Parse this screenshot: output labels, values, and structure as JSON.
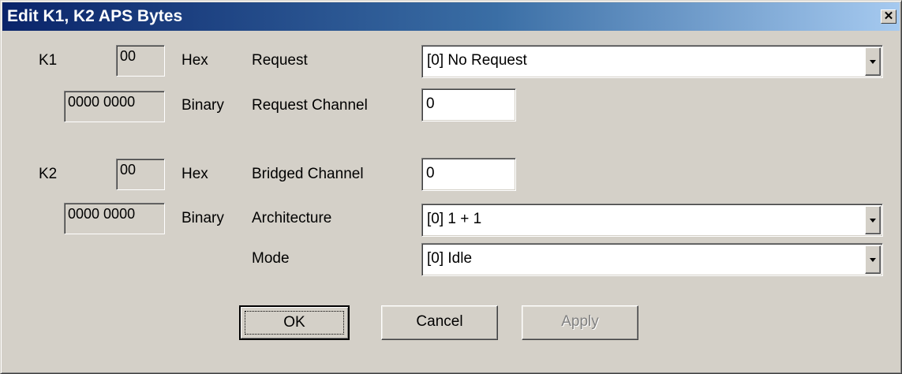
{
  "window": {
    "title": "Edit K1, K2 APS Bytes",
    "close_glyph": "✕"
  },
  "k1": {
    "label": "K1",
    "hex_value": "00",
    "hex_label": "Hex",
    "binary_value": "0000 0000",
    "binary_label": "Binary"
  },
  "k2": {
    "label": "K2",
    "hex_value": "00",
    "hex_label": "Hex",
    "binary_value": "0000 0000",
    "binary_label": "Binary"
  },
  "fields": {
    "request": {
      "label": "Request",
      "value": "[0]  No Request"
    },
    "request_channel": {
      "label": "Request Channel",
      "value": "0"
    },
    "bridged_channel": {
      "label": "Bridged Channel",
      "value": "0"
    },
    "architecture": {
      "label": "Architecture",
      "value": "[0]  1 + 1"
    },
    "mode": {
      "label": "Mode",
      "value": "[0]  Idle"
    }
  },
  "buttons": {
    "ok": "OK",
    "cancel": "Cancel",
    "apply": "Apply"
  },
  "colors": {
    "title_gradient_start": "#0a246a",
    "title_gradient_end": "#a6caf0",
    "face": "#d4d0c8"
  },
  "icons": {
    "close": "close-icon",
    "dropdown": "chevron-down-icon"
  }
}
